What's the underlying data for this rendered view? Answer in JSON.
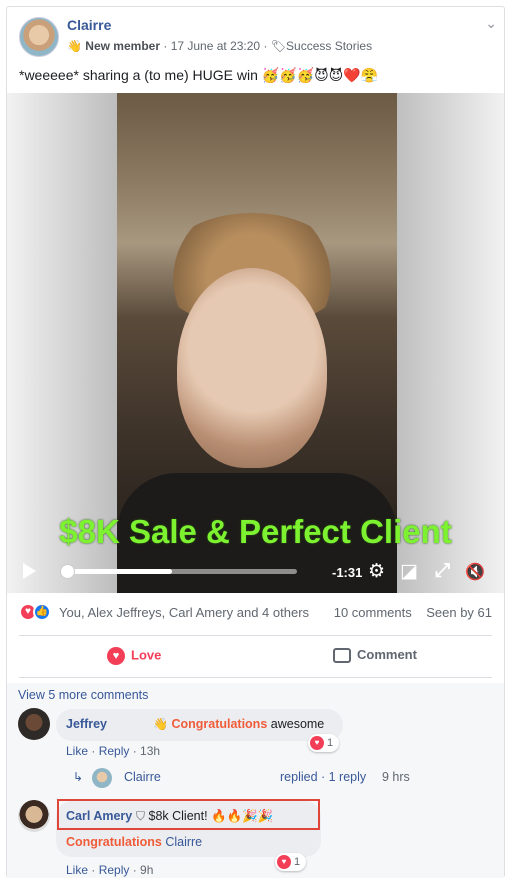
{
  "post": {
    "author": "Clairre",
    "badge_icon": "wave-icon",
    "badge_label": "New member",
    "timestamp": "17 June at 23:20",
    "topic_icon": "tag-icon",
    "topic": "Success Stories",
    "text": "*weeeee* sharing a (to me) HUGE win 🥳🥳🥳😈😈❤️😤"
  },
  "video": {
    "overlay_text": "$8K Sale & Perfect Client",
    "time_remaining": "-1:31",
    "progress_fraction": 0.47,
    "controls": {
      "settings_icon": "⚙",
      "pip_icon": "◪",
      "fullscreen_icon": "⤢",
      "mute_icon": "🔇"
    }
  },
  "reactions": {
    "names": "You, Alex Jeffreys, Carl Amery and 4 others",
    "comments_count": "10 comments",
    "seen_by": "Seen by 61"
  },
  "actions": {
    "love_label": "Love",
    "comment_label": "Comment"
  },
  "comments": {
    "view_more": "View 5 more comments",
    "items": [
      {
        "author": "Jeffrey",
        "badge_label": "Congratulations",
        "text": "awesome",
        "like": "Like",
        "reply": "Reply",
        "time": "13h",
        "reaction_count": "1",
        "reply_summary": {
          "author": "Clairre",
          "replied": "replied · 1 reply",
          "time": "9 hrs"
        }
      },
      {
        "author": "Carl Amery",
        "text": "$8k Client! 🔥🔥🎉🎉",
        "tag_label": "Congratulations",
        "tag_target": "Clairre",
        "like": "Like",
        "reply": "Reply",
        "time": "9h",
        "reaction_count": "1"
      }
    ]
  },
  "colors": {
    "link": "#385898",
    "love": "#f33e58",
    "congrats": "#f05c3a",
    "highlight_box": "#e0453a",
    "overlay_text": "#7cf230"
  }
}
